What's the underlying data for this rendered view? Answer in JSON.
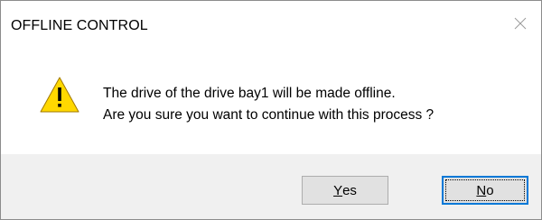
{
  "window": {
    "title": "OFFLINE CONTROL",
    "close_icon": "close-icon"
  },
  "message": {
    "icon": "warning-icon",
    "line1": "The drive of the drive bay1 will be made offline.",
    "line2": "Are you sure you want to continue with this process ?"
  },
  "buttons": {
    "yes": {
      "mnemonic": "Y",
      "rest": "es"
    },
    "no": {
      "mnemonic": "N",
      "rest": "o"
    }
  },
  "colors": {
    "footer_background": "#f0f0f0",
    "focus_border": "#0078d7",
    "warning_fill": "#ffd800"
  }
}
